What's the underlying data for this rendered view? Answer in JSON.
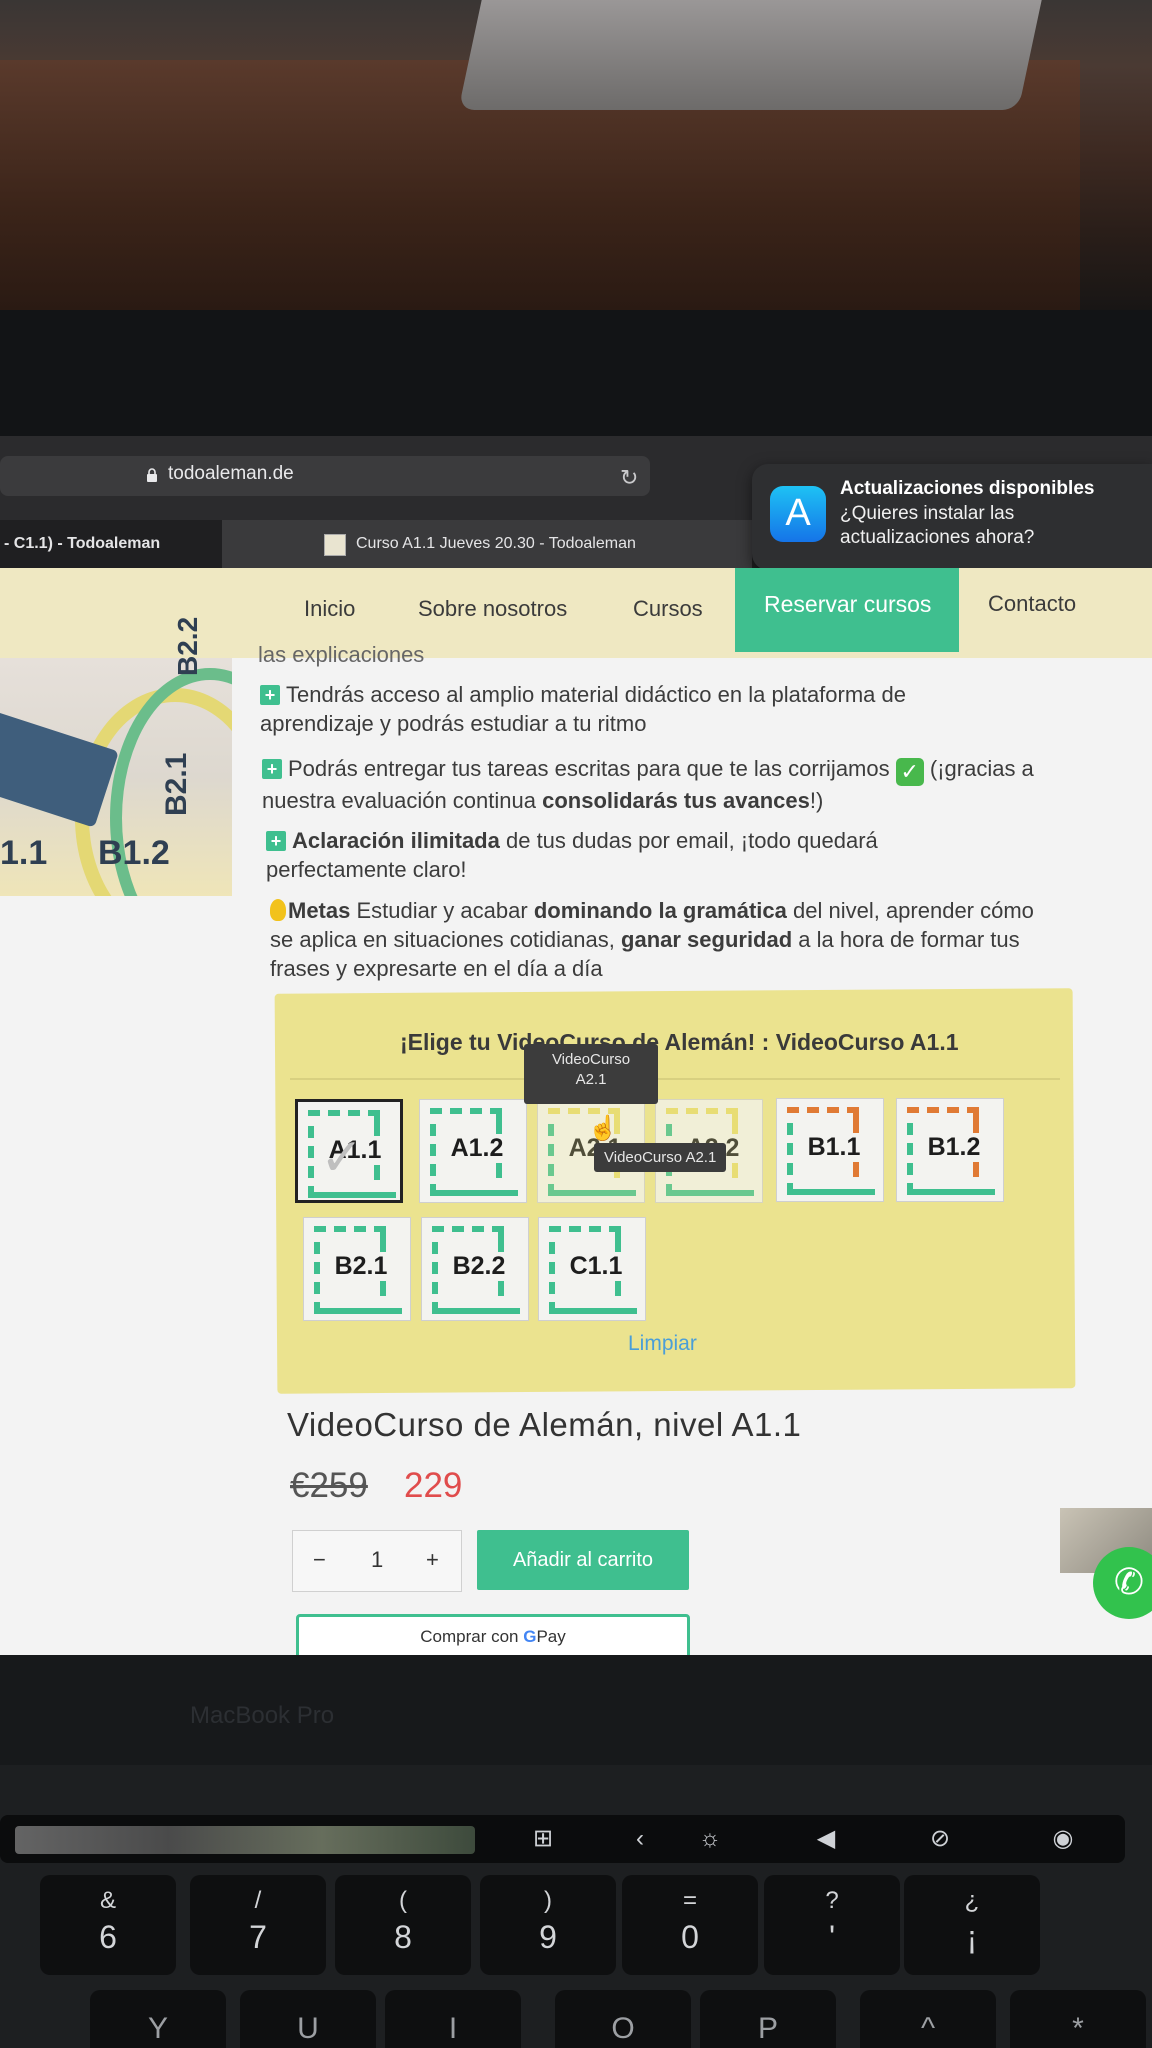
{
  "browser": {
    "url": "todoaleman.de",
    "tabs": [
      {
        "title": "- C1.1) - Todoaleman"
      },
      {
        "title": "Curso A1.1 Jueves 20.30 - Todoaleman"
      }
    ]
  },
  "notification": {
    "title": "Actualizaciones disponibles",
    "body": "¿Quieres instalar las actualizaciones ahora?"
  },
  "nav": {
    "items": [
      "Inicio",
      "Sobre nosotros",
      "Cursos",
      "Reservar cursos",
      "Contacto"
    ],
    "active": "Reservar cursos"
  },
  "side_image": {
    "labels": [
      "1.1",
      "B1.2",
      "B2.1",
      "B2.2"
    ]
  },
  "content": {
    "partial_line": "las explicaciones",
    "bullets": [
      {
        "text": "Tendrás acceso al amplio material didáctico en la plataforma de aprendizaje y podrás estudiar a tu ritmo"
      },
      {
        "pre": "Podrás entregar tus tareas escritas para que te las corrijamos",
        "post": "(¡gracias a nuestra evaluación continua",
        "bold": "consolidarás tus avances",
        "end": "!)"
      },
      {
        "bold": "Aclaración ilimitada",
        "text": "de tus dudas por email, ¡todo quedará perfectamente claro!"
      },
      {
        "bold1": "Metas",
        "t1": "Estudiar y acabar",
        "bold2": "dominando la gramática",
        "t2": "del nivel, aprender cómo se aplica en situaciones cotidianas,",
        "bold3": "ganar seguridad",
        "t3": "a la hora de formar tus frases y expresarte en el día a día"
      }
    ]
  },
  "selector": {
    "title": "¡Elige tu VideoCurso de Alemán! :",
    "selected_value": "VideoCurso A1.1",
    "options": [
      "A1.1",
      "A1.2",
      "A2.1",
      "A2.2",
      "B1.1",
      "B1.2",
      "B2.1",
      "B2.2",
      "C1.1"
    ],
    "tooltip_upper_1": "VideoCurso",
    "tooltip_upper_2": "A2.1",
    "tooltip_lower": "VideoCurso A2.1",
    "clear_label": "Limpiar"
  },
  "product": {
    "title": "VideoCurso de Alemán, nivel A1.1",
    "old_price": "€259",
    "new_price": "229",
    "quantity": "1",
    "minus": "−",
    "plus": "+",
    "add_to_cart": "Añadir al carrito",
    "buy_with": "Comprar con",
    "gpay_g": "G",
    "gpay_pay": "Pay"
  },
  "hardware": {
    "bezel_label": "MacBook Pro",
    "keys": [
      {
        "top": "&",
        "bottom": "6"
      },
      {
        "top": "/",
        "bottom": "7"
      },
      {
        "top": "(",
        "bottom": "8"
      },
      {
        "top": ")",
        "bottom": "9"
      },
      {
        "top": "=",
        "bottom": "0"
      },
      {
        "top": "?",
        "bottom": "'"
      },
      {
        "top": "¿",
        "bottom": "¡"
      }
    ],
    "bottom_row": [
      "Y",
      "U",
      "I",
      "O",
      "P",
      "^",
      "*"
    ]
  },
  "colors": {
    "accent": "#3fbf8f",
    "nav_bg": "#efe8c2",
    "panel_bg": "#ebe38f",
    "sale_price": "#e04c4c",
    "link": "#4a9ed8"
  }
}
